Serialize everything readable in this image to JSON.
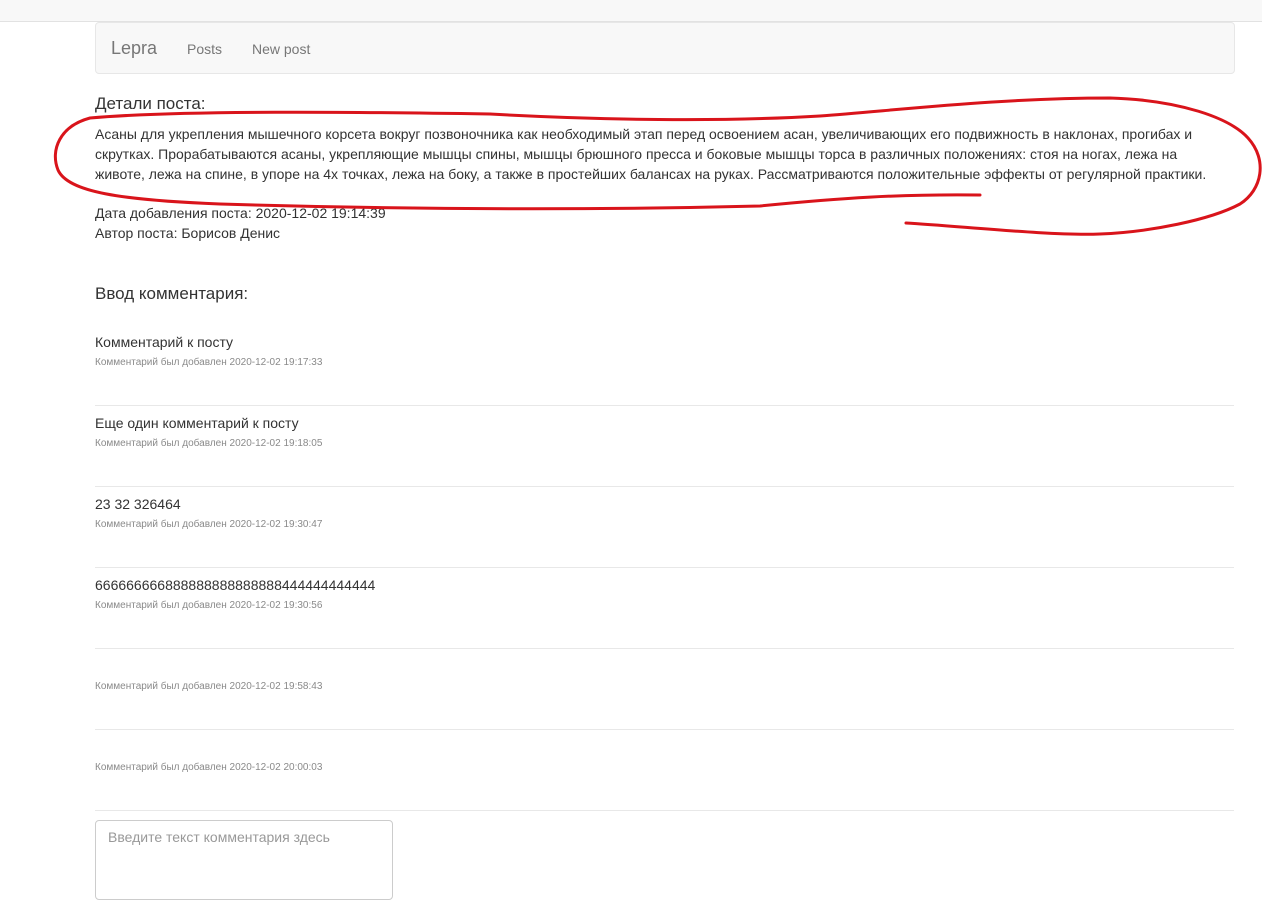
{
  "navbar": {
    "brand": "Lepra",
    "links": [
      "Posts",
      "New post"
    ]
  },
  "post": {
    "heading": "Детали поста:",
    "body": "Асаны для укрепления мышечного корсета вокруг позвоночника как необходимый этап перед освоением асан, увеличивающих его подвижность в наклонах, прогибах и скрутках. Прорабатываются асаны, укрепляющие мышцы спины, мышцы брюшного пресса и боковые мышцы торса в различных положениях: стоя на ногах, лежа на животе, лежа на спине, в упоре на 4х точках, лежа на боку, а также в простейших балансах на руках. Рассматриваются положительные эффекты от регулярной практики.",
    "date": "Дата добавления поста: 2020-12-02 19:14:39",
    "author": "Автор поста: Борисов Денис"
  },
  "comments_section": {
    "heading": "Ввод комментария:",
    "items": [
      {
        "text": "Комментарий к посту",
        "meta": "Комментарий был добавлен 2020-12-02 19:17:33"
      },
      {
        "text": "Еще один комментарий к посту",
        "meta": "Комментарий был добавлен 2020-12-02 19:18:05"
      },
      {
        "text": "23 32 326464",
        "meta": "Комментарий был добавлен 2020-12-02 19:30:47"
      },
      {
        "text": "666666666888888888888888444444444444",
        "meta": "Комментарий был добавлен 2020-12-02 19:30:56"
      },
      {
        "text": "",
        "meta": "Комментарий был добавлен 2020-12-02 19:58:43"
      },
      {
        "text": "",
        "meta": "Комментарий был добавлен 2020-12-02 20:00:03"
      }
    ],
    "input_placeholder": "Введите текст комментария здесь"
  },
  "colors": {
    "annotation": "#d9141b",
    "navbar_bg": "#f8f8f8",
    "muted_text": "#8a8a8a"
  }
}
